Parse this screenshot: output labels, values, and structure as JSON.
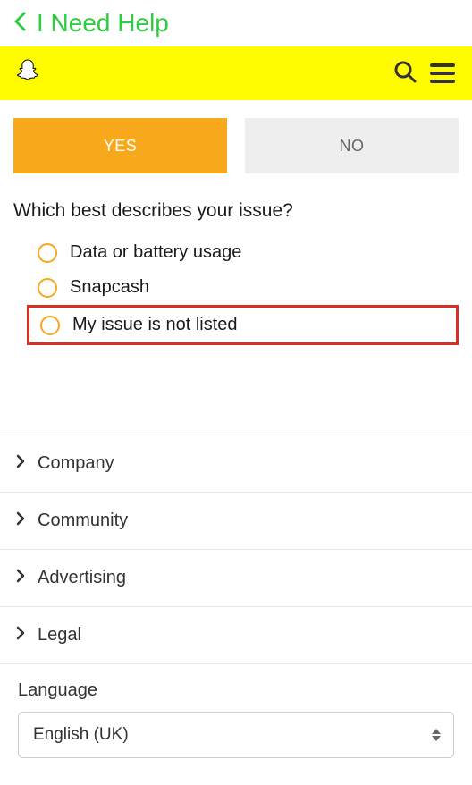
{
  "header": {
    "title": "I Need Help"
  },
  "buttons": {
    "yes": "YES",
    "no": "NO"
  },
  "question": "Which best describes your issue?",
  "options": [
    {
      "label": "Data or battery usage",
      "highlighted": false
    },
    {
      "label": "Snapcash",
      "highlighted": false
    },
    {
      "label": "My issue is not listed",
      "highlighted": true
    }
  ],
  "footer": {
    "links": [
      "Company",
      "Community",
      "Advertising",
      "Legal"
    ],
    "language_label": "Language",
    "language_value": "English (UK)"
  }
}
